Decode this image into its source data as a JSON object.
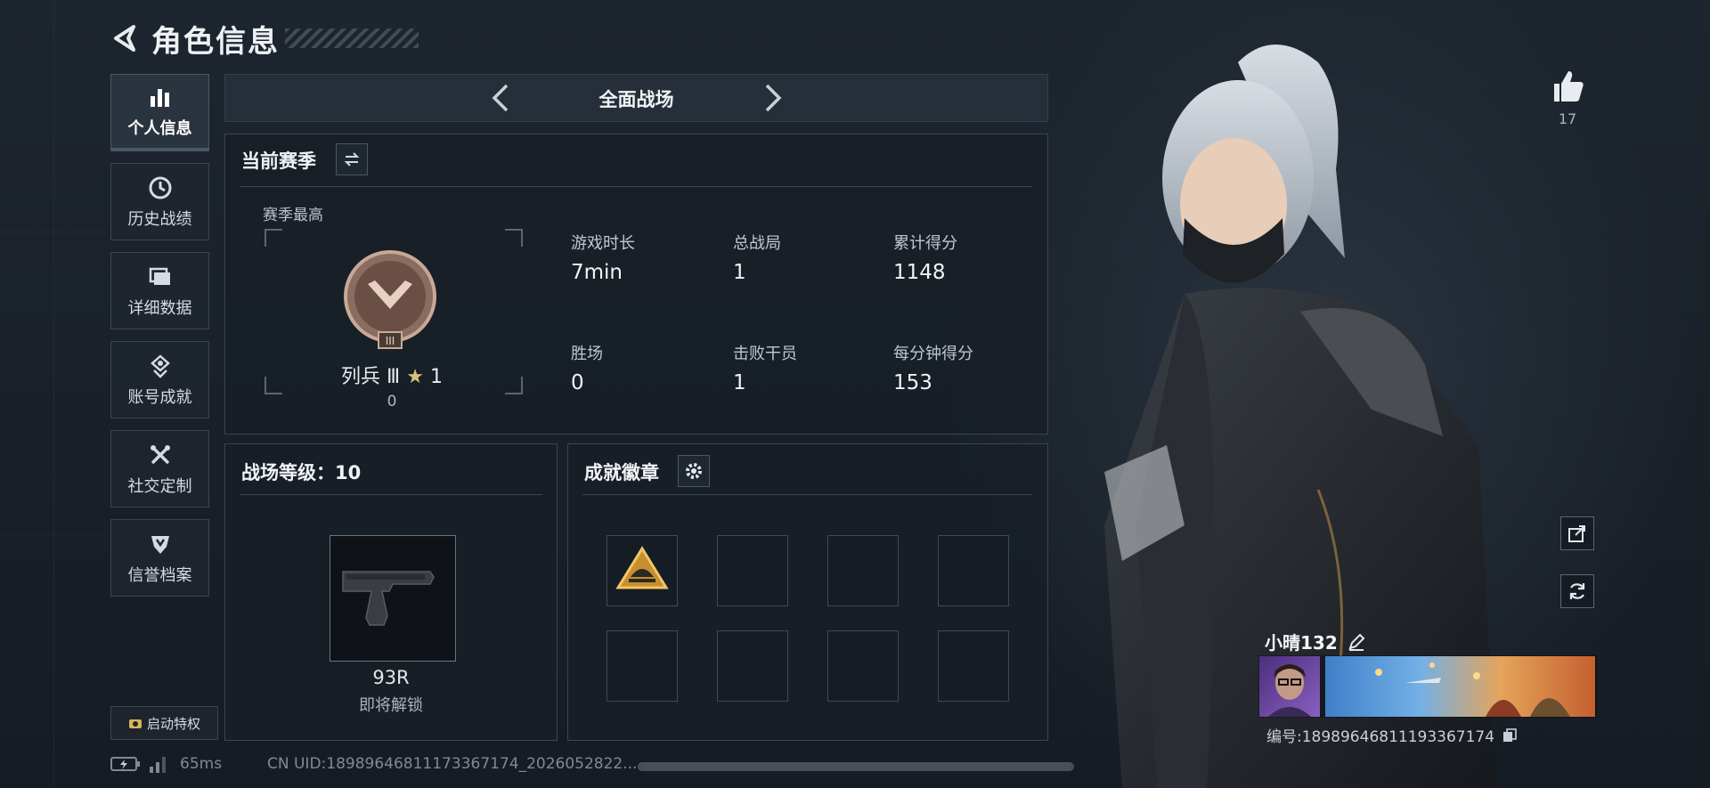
{
  "header": {
    "title": "角色信息"
  },
  "nav": {
    "items": [
      {
        "label": "个人信息",
        "icon": "bar-chart-icon",
        "active": true
      },
      {
        "label": "历史战绩",
        "icon": "history-clock-icon",
        "active": false
      },
      {
        "label": "详细数据",
        "icon": "folder-icon",
        "active": false
      },
      {
        "label": "账号成就",
        "icon": "achievement-icon",
        "active": false
      },
      {
        "label": "社交定制",
        "icon": "tools-icon",
        "active": false
      },
      {
        "label": "信誉档案",
        "icon": "shield-icon",
        "active": false
      }
    ],
    "perk_label": "启动特权"
  },
  "mode": {
    "label": "全面战场"
  },
  "season": {
    "title": "当前赛季",
    "subtitle": "赛季最高",
    "rank_name": "列兵 Ⅲ",
    "rank_stars": "1",
    "rank_points": "0",
    "stats": [
      {
        "label": "游戏时长",
        "value": "7min"
      },
      {
        "label": "总战局",
        "value": "1"
      },
      {
        "label": "累计得分",
        "value": "1148"
      },
      {
        "label": "胜场",
        "value": "0"
      },
      {
        "label": "击败干员",
        "value": "1"
      },
      {
        "label": "每分钟得分",
        "value": "153"
      }
    ]
  },
  "level": {
    "title": "战场等级：10",
    "weapon_name": "93R",
    "weapon_status": "即将解锁"
  },
  "badges": {
    "title": "成就徽章"
  },
  "status": {
    "ping": "65ms",
    "uid": "CN UID:18989646811173367174_2026052822..."
  },
  "player": {
    "name": "小晴132",
    "id": "编号:18989646811193367174",
    "likes": "17"
  },
  "colors": {
    "accent": "#5fd1b0",
    "panel_border": "#3a4551"
  }
}
